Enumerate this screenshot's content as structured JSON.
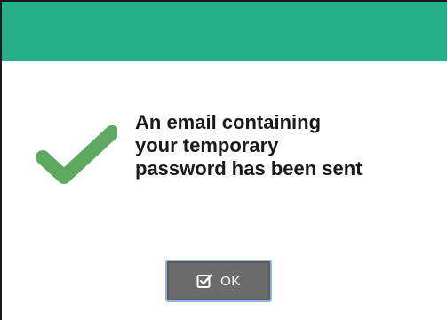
{
  "colors": {
    "title_bar": "#27ad87",
    "check": "#5fa85f",
    "button_bg": "#6b6b6b",
    "button_border": "#8db5e3"
  },
  "dialog": {
    "message_lines": [
      "An email containing",
      "your temporary",
      "password has been sent"
    ],
    "status_icon": "checkmark-icon",
    "ok_button": {
      "label": "OK",
      "icon": "checkbox-checked-icon"
    }
  }
}
